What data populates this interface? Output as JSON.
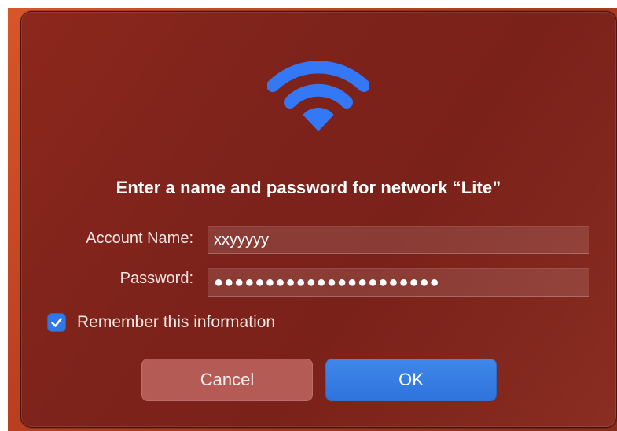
{
  "dialog": {
    "title": "Enter a name and password for network “Lite”",
    "account_label": "Account Name:",
    "account_value": "xxyyyyy",
    "password_label": "Password:",
    "password_value": "●●●●●●●●●●●●●●●●●●●●●●",
    "remember_label": "Remember this information",
    "remember_checked": true,
    "cancel_label": "Cancel",
    "ok_label": "OK",
    "icon": "wifi-icon"
  },
  "colors": {
    "dialog_bg": "#7e231b",
    "accent_blue": "#2f78e6",
    "cancel_bg": "#b55b55"
  }
}
